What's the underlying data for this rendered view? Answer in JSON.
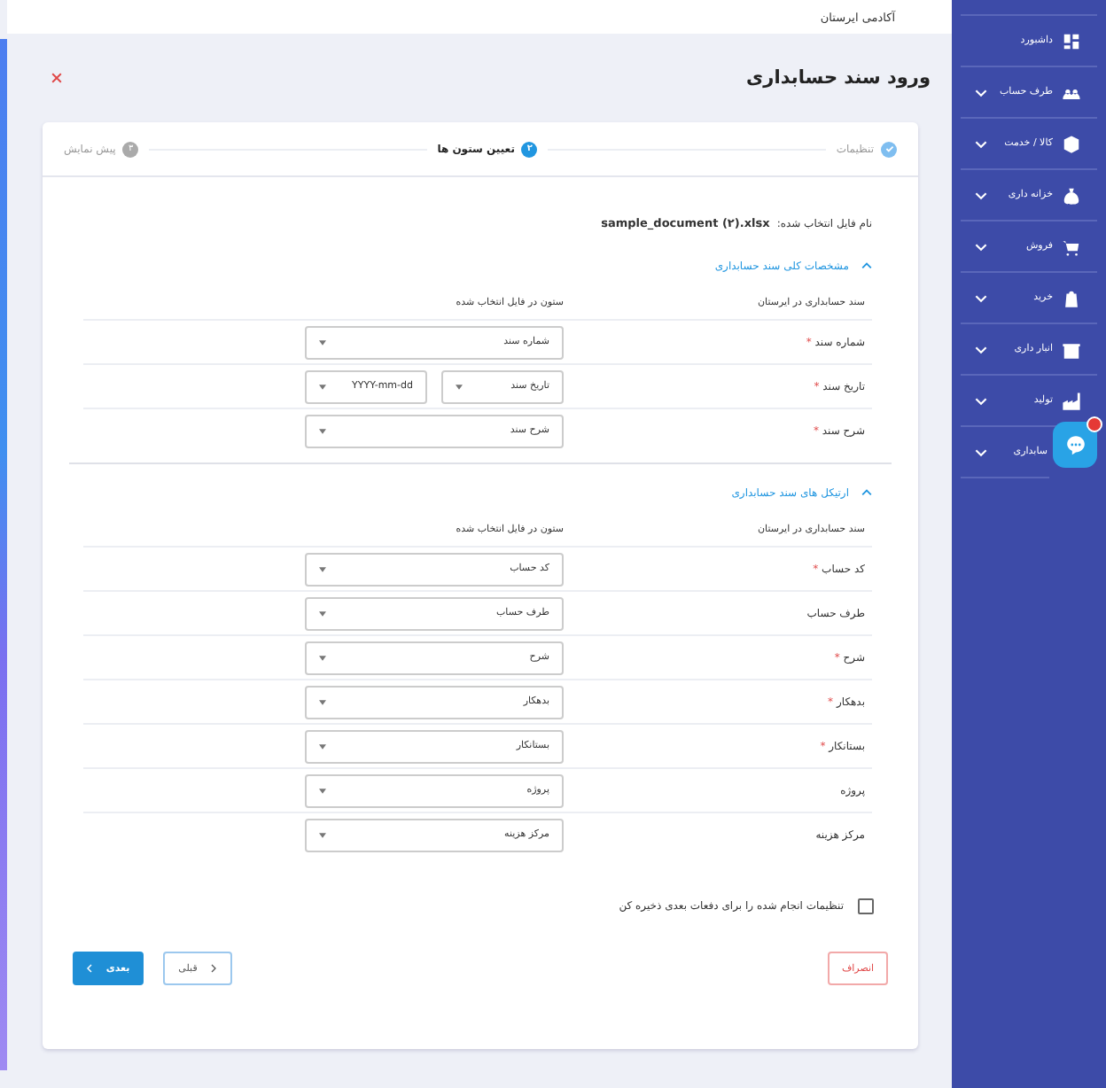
{
  "header": {
    "company": "آکادمی ایرستان"
  },
  "sidebar": {
    "items": [
      {
        "label": "داشبورد",
        "expandable": false
      },
      {
        "label": "طرف حساب",
        "expandable": true
      },
      {
        "label": "کالا / خدمت",
        "expandable": true
      },
      {
        "label": "خزانه داری",
        "expandable": true
      },
      {
        "label": "فروش",
        "expandable": true
      },
      {
        "label": "خرید",
        "expandable": true
      },
      {
        "label": "انبار داری",
        "expandable": true
      },
      {
        "label": "تولید",
        "expandable": true
      },
      {
        "label": "سابداری",
        "expandable": true
      }
    ]
  },
  "dialog": {
    "title": "ورود سند حسابداری",
    "steps": [
      {
        "label": "تنظیمات",
        "done": true,
        "selected": false
      },
      {
        "label": "تعیین ستون ها",
        "number": "۲",
        "done": false,
        "selected": true
      },
      {
        "label": "پیش نمایش",
        "number": "۳",
        "done": false,
        "selected": false
      }
    ],
    "file": {
      "label": "نام فایل انتخاب شده:",
      "name": "sample_document (۲).xlsx"
    },
    "sections": [
      {
        "title": "مشخصات کلی سند حسابداری",
        "expanded": true,
        "col_left": "ستون در فایل انتخاب شده",
        "col_right": "سند حسابداری در ایرستان",
        "rows": [
          {
            "label": "شماره سند",
            "required_mark": "*",
            "selects": [
              "شماره سند"
            ]
          },
          {
            "label": "تاریخ سند",
            "required_mark": "*",
            "selects": [
              "تاریخ سند",
              "YYYY-mm-dd"
            ]
          },
          {
            "label": "شرح سند",
            "required_mark": "*",
            "selects": [
              "شرح سند"
            ]
          }
        ]
      },
      {
        "title": "ارتیکل های سند حسابداری",
        "expanded": true,
        "col_left": "ستون در فایل انتخاب شده",
        "col_right": "سند حسابداری در ایرستان",
        "rows": [
          {
            "label": "کد حساب",
            "required_mark": "*",
            "selects": [
              "کد حساب"
            ]
          },
          {
            "label": "طرف حساب",
            "selects": [
              "طرف حساب"
            ]
          },
          {
            "label": "شرح",
            "required_mark": "*",
            "selects": [
              "شرح"
            ]
          },
          {
            "label": "بدهکار",
            "required_mark": "*",
            "selects": [
              "بدهکار"
            ]
          },
          {
            "label": "بستانکار",
            "required_mark": "*",
            "selects": [
              "بستانکار"
            ]
          },
          {
            "label": "پروژه",
            "selects": [
              "پروژه"
            ]
          },
          {
            "label": "مرکز هزینه",
            "selects": [
              "مرکز هزینه"
            ]
          }
        ]
      }
    ],
    "save_settings": {
      "label": "تنظیمات انجام شده را برای دفعات بعدی ذخیره کن",
      "checked": false
    },
    "buttons": [
      {
        "label": "انصراف",
        "kind": "cancel"
      },
      {
        "label": "قبلی",
        "kind": "back"
      },
      {
        "label": "بعدی",
        "kind": "next"
      }
    ]
  }
}
